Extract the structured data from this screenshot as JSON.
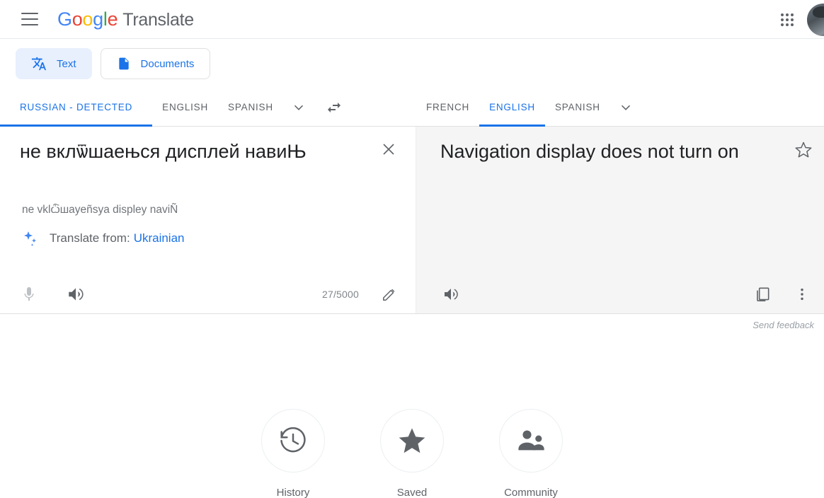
{
  "header": {
    "menu_icon": "hamburger-menu-icon",
    "logo_parts": [
      {
        "char": "G",
        "color": "#4285f4"
      },
      {
        "char": "o",
        "color": "#ea4335"
      },
      {
        "char": "o",
        "color": "#fbbc05"
      },
      {
        "char": "g",
        "color": "#4285f4"
      },
      {
        "char": "l",
        "color": "#34a853"
      },
      {
        "char": "e",
        "color": "#ea4335"
      }
    ],
    "product": "Translate",
    "apps_icon": "google-apps-grid-icon",
    "avatar_icon": "user-avatar"
  },
  "modes": {
    "text": {
      "label": "Text",
      "icon": "translate-icon",
      "selected": true
    },
    "documents": {
      "label": "Documents",
      "icon": "document-icon",
      "selected": false
    }
  },
  "languages": {
    "source": {
      "items": [
        "RUSSIAN - DETECTED",
        "ENGLISH",
        "SPANISH"
      ],
      "selected": "RUSSIAN - DETECTED",
      "dropdown_icon": "chevron-down-icon"
    },
    "swap_icon": "swap-languages-icon",
    "target": {
      "items": [
        "FRENCH",
        "ENGLISH",
        "SPANISH"
      ],
      "selected": "ENGLISH",
      "dropdown_icon": "chevron-down-icon"
    }
  },
  "source_panel": {
    "text": "не вклѿшаењся дисплей навиЊ",
    "clear_icon": "close-icon",
    "transliteration": "ne vklѽшayeñsya displey naviÑ",
    "translate_from_label": "Translate from:",
    "translate_from_language": "Ukrainian",
    "sparkle_icon": "sparkle-icon",
    "mic_icon": "microphone-icon",
    "speaker_icon": "speaker-icon",
    "char_count": "27/5000",
    "edit_icon": "pencil-icon"
  },
  "target_panel": {
    "text": "Navigation display does not turn on",
    "star_icon": "star-outline-icon",
    "speaker_icon": "speaker-icon",
    "copy_icon": "copy-icon",
    "more_icon": "more-vertical-icon"
  },
  "feedback": {
    "label": "Send feedback"
  },
  "shortcuts": [
    {
      "label": "History",
      "icon": "history-clock-icon"
    },
    {
      "label": "Saved",
      "icon": "star-filled-icon"
    },
    {
      "label": "Community",
      "icon": "community-people-icon"
    }
  ],
  "colors": {
    "accent_blue": "#1a73e8",
    "chip_bg": "#e8f0fe",
    "panel_bg": "#f5f5f5",
    "text_primary": "#202124",
    "text_secondary": "#5f6368"
  }
}
